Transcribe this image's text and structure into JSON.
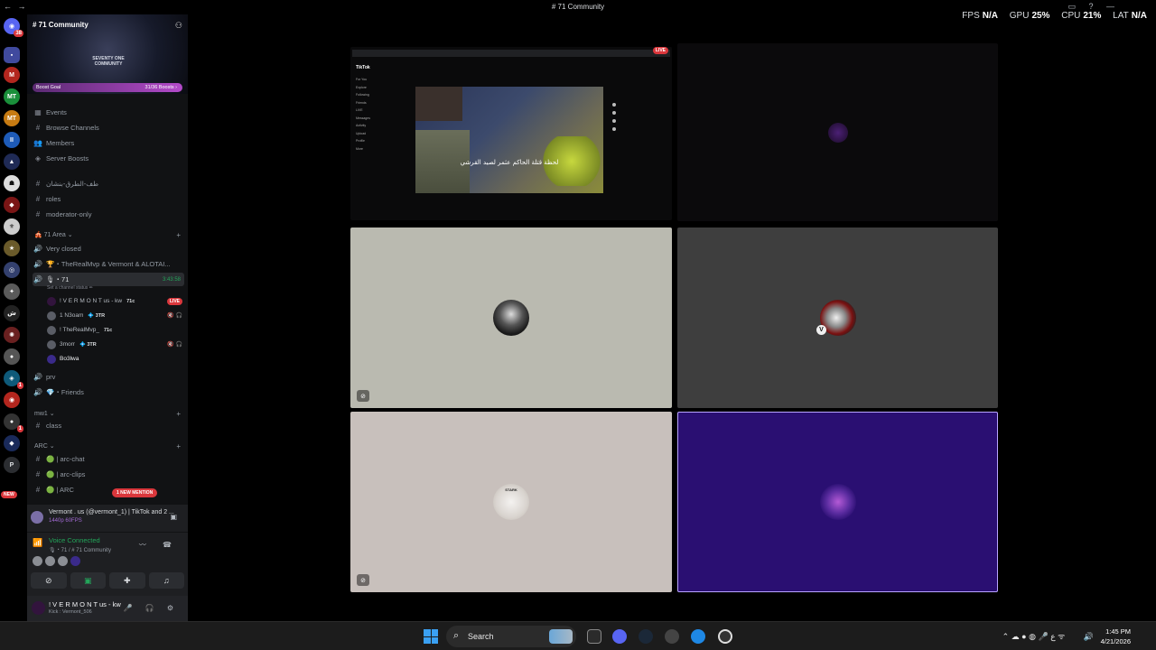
{
  "window": {
    "title": "# 71 Community",
    "nav": "← →"
  },
  "perf": {
    "fps_label": "FPS",
    "fps": "N/A",
    "gpu_label": "GPU",
    "gpu": "25%",
    "cpu_label": "CPU",
    "cpu": "21%",
    "lat_label": "LAT",
    "lat": "N/A"
  },
  "rail": {
    "home_badge": "38",
    "new_pill": "NEW",
    "p_label": "P",
    "icons": [
      {
        "name": "home",
        "color": "#5865f2"
      },
      {
        "name": "dm",
        "color": "#5865f2"
      },
      {
        "name": "m-server",
        "color": "#b3261e"
      },
      {
        "name": "mt-server-green",
        "color": "#1a8f3a"
      },
      {
        "name": "mt-server-orange",
        "color": "#c77b12"
      },
      {
        "name": "blue-server",
        "color": "#1e5bb8"
      },
      {
        "name": "dark-server",
        "color": "#1f2a55"
      },
      {
        "name": "bw-server",
        "color": "#ddd"
      },
      {
        "name": "red-server",
        "color": "#7a1515"
      },
      {
        "name": "purple-server",
        "color": "#433a6a"
      },
      {
        "name": "gold-server",
        "color": "#6a5a2a"
      },
      {
        "name": "blue2-server",
        "color": "#33406e"
      },
      {
        "name": "eagle-server",
        "color": "#5a5a5a"
      }
    ]
  },
  "server": {
    "name": "# 71 Community",
    "logo_line1": "SEVENTY ONE",
    "logo_line2": "COMMUNITY",
    "boost_label": "Boost Goal",
    "boost_value": "31/36 Boosts ›"
  },
  "nav_items": [
    "Events",
    "Browse Channels",
    "Members",
    "Server Boosts"
  ],
  "channels": {
    "top": [
      "طف-الطرق-بنشان",
      "roles",
      "moderator-only"
    ],
    "cat_area": "🎪 71 Area ⌄",
    "area_voice": [
      "Very closed",
      "🏆・TheRealMvp & Vermont & ALOTAI..."
    ],
    "active_voice": "🎙・71",
    "active_timer": "3:43:58",
    "status_sub": "Set a channel status ✏",
    "voice_users": [
      {
        "name": "! V E R M O N T us - kw",
        "tag": "71c",
        "right": "LIVE"
      },
      {
        "name": "1 N3oam",
        "tag": "💠 3TR",
        "right": "🔇 🎧"
      },
      {
        "name": "! TheRealMvp_",
        "tag": "71c",
        "right": ""
      },
      {
        "name": "3morr",
        "tag": "💠 3TR",
        "right": "🔇 🎧"
      },
      {
        "name": "Bo3lwa",
        "tag": "",
        "right": ""
      }
    ],
    "after_voice": [
      "prv",
      "💎・Friends"
    ],
    "cat_mw": "mw1 ⌄",
    "mw_channels": [
      "class"
    ],
    "cat_arc": "ARC ⌄",
    "arc_channels": [
      "🟢 | arc-chat",
      "🟢 | arc-clips",
      "🟢 | ARC"
    ],
    "new_mention": "1 NEW MENTION"
  },
  "activity": {
    "line1": "Vermont . us (@vermont_1) | TikTok and 2 ...",
    "line2": "1440p 60FPS"
  },
  "voice_panel": {
    "status": "Voice Connected",
    "sub": "🎙・71 / # 71 Community"
  },
  "user": {
    "name": "! V E R M O N T us - kw",
    "status": "Kick : Vermont_506"
  },
  "stage": {
    "live_label": "LIVE",
    "stream_site": "TikTok",
    "nav_items": [
      "For You",
      "Explore",
      "Following",
      "Friends",
      "LIVE",
      "Messages",
      "Activity",
      "Upload",
      "Profile",
      "More"
    ],
    "subtitle": "لحظة قتلة الحاكم عثمر لصيد القرشي",
    "stark_label": "STARK",
    "tile4_badge": "V"
  },
  "taskbar": {
    "search_label": "Search",
    "time": "1:45 PM",
    "date": "4/21/2026"
  }
}
